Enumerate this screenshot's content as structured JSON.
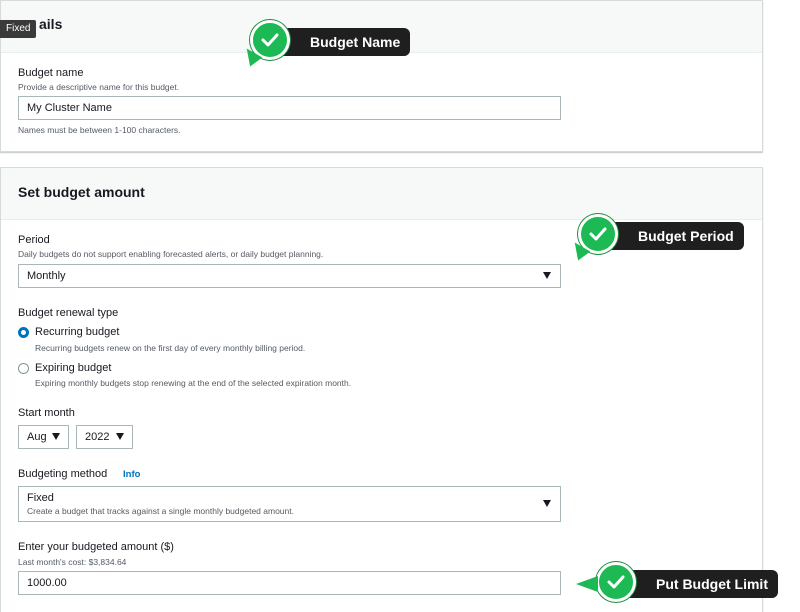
{
  "fixed_tag": "Fixed",
  "details": {
    "title": "ails",
    "budget_name_label": "Budget name",
    "budget_name_desc": "Provide a descriptive name for this budget.",
    "budget_name_value": "My Cluster Name",
    "budget_name_hint": "Names must be between 1-100 characters."
  },
  "amount": {
    "title": "Set budget amount",
    "period_label": "Period",
    "period_desc": "Daily budgets do not support enabling forecasted alerts, or daily budget planning.",
    "period_value": "Monthly",
    "renewal_label": "Budget renewal type",
    "recurring_label": "Recurring budget",
    "recurring_desc": "Recurring budgets renew on the first day of every monthly billing period.",
    "expiring_label": "Expiring budget",
    "expiring_desc": "Expiring monthly budgets stop renewing at the end of the selected expiration month.",
    "start_month_label": "Start month",
    "start_month_value": "Aug",
    "start_year_value": "2022",
    "method_label": "Budgeting method",
    "method_info": "Info",
    "method_value": "Fixed",
    "method_desc": "Create a budget that tracks against a single monthly budgeted amount.",
    "amount_label": "Enter your budgeted amount ($)",
    "amount_desc": "Last month's cost: $3,834.64",
    "amount_value": "1000.00"
  },
  "callouts": {
    "budget_name": "Budget Name",
    "budget_period": "Budget Period",
    "budget_limit": "Put Budget Limit"
  },
  "colors": {
    "accent": "#0073bb",
    "callout_green": "#1db954",
    "callout_dark": "#1f1f1f"
  },
  "icons": {
    "check": "check-icon",
    "dropdown": "caret-down-icon"
  }
}
